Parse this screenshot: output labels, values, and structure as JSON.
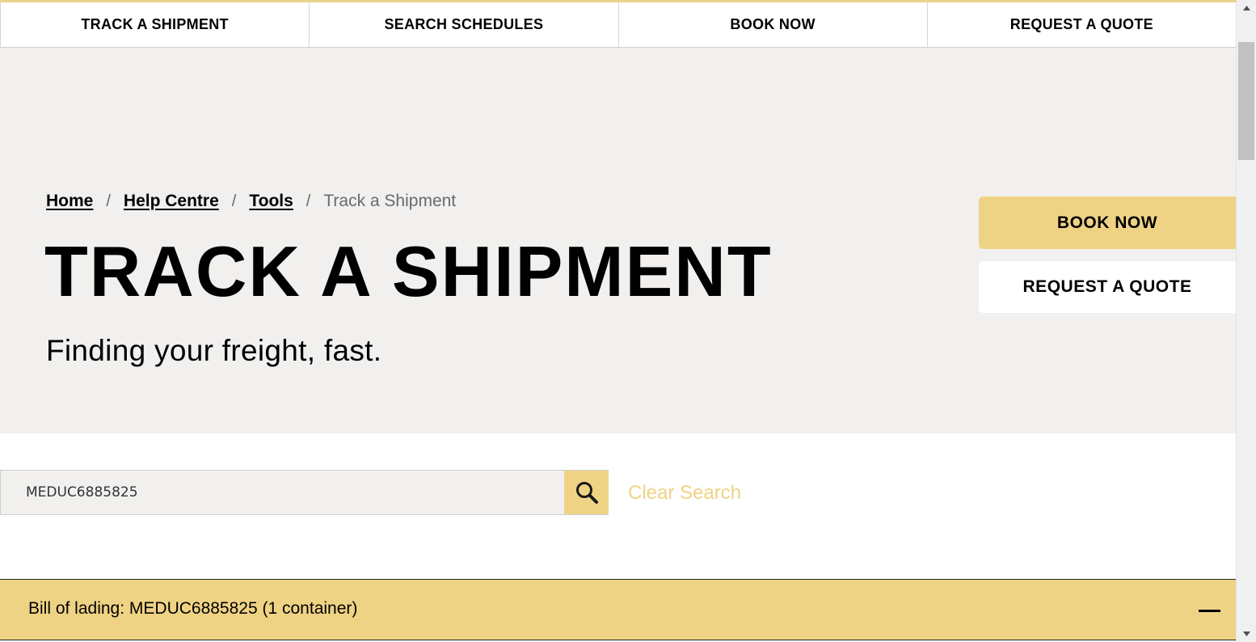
{
  "nav": {
    "items": [
      {
        "label": "TRACK A SHIPMENT"
      },
      {
        "label": "SEARCH SCHEDULES"
      },
      {
        "label": "BOOK NOW"
      },
      {
        "label": "REQUEST A QUOTE"
      }
    ]
  },
  "breadcrumb": {
    "items": [
      {
        "label": "Home"
      },
      {
        "label": "Help Centre"
      },
      {
        "label": "Tools"
      }
    ],
    "current": "Track a Shipment",
    "separator": "/"
  },
  "hero": {
    "title": "TRACK A SHIPMENT",
    "subtitle": "Finding your freight, fast.",
    "book_label": "BOOK NOW",
    "quote_label": "REQUEST A QUOTE"
  },
  "search": {
    "value": "MEDUC6885825",
    "clear_label": "Clear Search",
    "icon": "search-icon"
  },
  "result": {
    "bol_text": "Bill of lading: MEDUC6885825 (1 container)",
    "toggle_icon": "minus-icon"
  },
  "colors": {
    "accent": "#efd385",
    "hero_bg": "#f1f0ee"
  }
}
